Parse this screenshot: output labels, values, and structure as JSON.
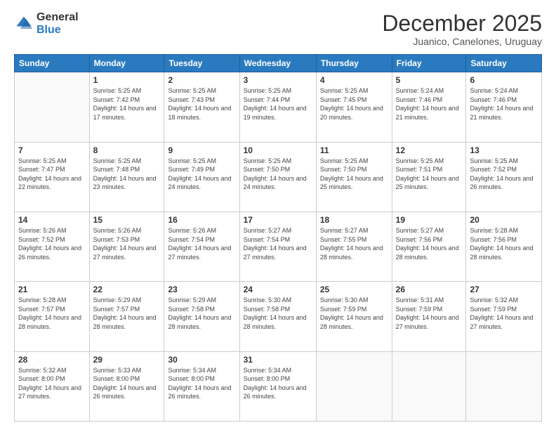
{
  "logo": {
    "general": "General",
    "blue": "Blue"
  },
  "header": {
    "month": "December 2025",
    "location": "Juanico, Canelones, Uruguay"
  },
  "days_of_week": [
    "Sunday",
    "Monday",
    "Tuesday",
    "Wednesday",
    "Thursday",
    "Friday",
    "Saturday"
  ],
  "weeks": [
    [
      {
        "day": "",
        "sunrise": "",
        "sunset": "",
        "daylight": ""
      },
      {
        "day": "1",
        "sunrise": "Sunrise: 5:25 AM",
        "sunset": "Sunset: 7:42 PM",
        "daylight": "Daylight: 14 hours and 17 minutes."
      },
      {
        "day": "2",
        "sunrise": "Sunrise: 5:25 AM",
        "sunset": "Sunset: 7:43 PM",
        "daylight": "Daylight: 14 hours and 18 minutes."
      },
      {
        "day": "3",
        "sunrise": "Sunrise: 5:25 AM",
        "sunset": "Sunset: 7:44 PM",
        "daylight": "Daylight: 14 hours and 19 minutes."
      },
      {
        "day": "4",
        "sunrise": "Sunrise: 5:25 AM",
        "sunset": "Sunset: 7:45 PM",
        "daylight": "Daylight: 14 hours and 20 minutes."
      },
      {
        "day": "5",
        "sunrise": "Sunrise: 5:24 AM",
        "sunset": "Sunset: 7:46 PM",
        "daylight": "Daylight: 14 hours and 21 minutes."
      },
      {
        "day": "6",
        "sunrise": "Sunrise: 5:24 AM",
        "sunset": "Sunset: 7:46 PM",
        "daylight": "Daylight: 14 hours and 21 minutes."
      }
    ],
    [
      {
        "day": "7",
        "sunrise": "Sunrise: 5:25 AM",
        "sunset": "Sunset: 7:47 PM",
        "daylight": "Daylight: 14 hours and 22 minutes."
      },
      {
        "day": "8",
        "sunrise": "Sunrise: 5:25 AM",
        "sunset": "Sunset: 7:48 PM",
        "daylight": "Daylight: 14 hours and 23 minutes."
      },
      {
        "day": "9",
        "sunrise": "Sunrise: 5:25 AM",
        "sunset": "Sunset: 7:49 PM",
        "daylight": "Daylight: 14 hours and 24 minutes."
      },
      {
        "day": "10",
        "sunrise": "Sunrise: 5:25 AM",
        "sunset": "Sunset: 7:50 PM",
        "daylight": "Daylight: 14 hours and 24 minutes."
      },
      {
        "day": "11",
        "sunrise": "Sunrise: 5:25 AM",
        "sunset": "Sunset: 7:50 PM",
        "daylight": "Daylight: 14 hours and 25 minutes."
      },
      {
        "day": "12",
        "sunrise": "Sunrise: 5:25 AM",
        "sunset": "Sunset: 7:51 PM",
        "daylight": "Daylight: 14 hours and 25 minutes."
      },
      {
        "day": "13",
        "sunrise": "Sunrise: 5:25 AM",
        "sunset": "Sunset: 7:52 PM",
        "daylight": "Daylight: 14 hours and 26 minutes."
      }
    ],
    [
      {
        "day": "14",
        "sunrise": "Sunrise: 5:26 AM",
        "sunset": "Sunset: 7:52 PM",
        "daylight": "Daylight: 14 hours and 26 minutes."
      },
      {
        "day": "15",
        "sunrise": "Sunrise: 5:26 AM",
        "sunset": "Sunset: 7:53 PM",
        "daylight": "Daylight: 14 hours and 27 minutes."
      },
      {
        "day": "16",
        "sunrise": "Sunrise: 5:26 AM",
        "sunset": "Sunset: 7:54 PM",
        "daylight": "Daylight: 14 hours and 27 minutes."
      },
      {
        "day": "17",
        "sunrise": "Sunrise: 5:27 AM",
        "sunset": "Sunset: 7:54 PM",
        "daylight": "Daylight: 14 hours and 27 minutes."
      },
      {
        "day": "18",
        "sunrise": "Sunrise: 5:27 AM",
        "sunset": "Sunset: 7:55 PM",
        "daylight": "Daylight: 14 hours and 28 minutes."
      },
      {
        "day": "19",
        "sunrise": "Sunrise: 5:27 AM",
        "sunset": "Sunset: 7:56 PM",
        "daylight": "Daylight: 14 hours and 28 minutes."
      },
      {
        "day": "20",
        "sunrise": "Sunrise: 5:28 AM",
        "sunset": "Sunset: 7:56 PM",
        "daylight": "Daylight: 14 hours and 28 minutes."
      }
    ],
    [
      {
        "day": "21",
        "sunrise": "Sunrise: 5:28 AM",
        "sunset": "Sunset: 7:57 PM",
        "daylight": "Daylight: 14 hours and 28 minutes."
      },
      {
        "day": "22",
        "sunrise": "Sunrise: 5:29 AM",
        "sunset": "Sunset: 7:57 PM",
        "daylight": "Daylight: 14 hours and 28 minutes."
      },
      {
        "day": "23",
        "sunrise": "Sunrise: 5:29 AM",
        "sunset": "Sunset: 7:58 PM",
        "daylight": "Daylight: 14 hours and 28 minutes."
      },
      {
        "day": "24",
        "sunrise": "Sunrise: 5:30 AM",
        "sunset": "Sunset: 7:58 PM",
        "daylight": "Daylight: 14 hours and 28 minutes."
      },
      {
        "day": "25",
        "sunrise": "Sunrise: 5:30 AM",
        "sunset": "Sunset: 7:59 PM",
        "daylight": "Daylight: 14 hours and 28 minutes."
      },
      {
        "day": "26",
        "sunrise": "Sunrise: 5:31 AM",
        "sunset": "Sunset: 7:59 PM",
        "daylight": "Daylight: 14 hours and 27 minutes."
      },
      {
        "day": "27",
        "sunrise": "Sunrise: 5:32 AM",
        "sunset": "Sunset: 7:59 PM",
        "daylight": "Daylight: 14 hours and 27 minutes."
      }
    ],
    [
      {
        "day": "28",
        "sunrise": "Sunrise: 5:32 AM",
        "sunset": "Sunset: 8:00 PM",
        "daylight": "Daylight: 14 hours and 27 minutes."
      },
      {
        "day": "29",
        "sunrise": "Sunrise: 5:33 AM",
        "sunset": "Sunset: 8:00 PM",
        "daylight": "Daylight: 14 hours and 26 minutes."
      },
      {
        "day": "30",
        "sunrise": "Sunrise: 5:34 AM",
        "sunset": "Sunset: 8:00 PM",
        "daylight": "Daylight: 14 hours and 26 minutes."
      },
      {
        "day": "31",
        "sunrise": "Sunrise: 5:34 AM",
        "sunset": "Sunset: 8:00 PM",
        "daylight": "Daylight: 14 hours and 26 minutes."
      },
      {
        "day": "",
        "sunrise": "",
        "sunset": "",
        "daylight": ""
      },
      {
        "day": "",
        "sunrise": "",
        "sunset": "",
        "daylight": ""
      },
      {
        "day": "",
        "sunrise": "",
        "sunset": "",
        "daylight": ""
      }
    ]
  ]
}
